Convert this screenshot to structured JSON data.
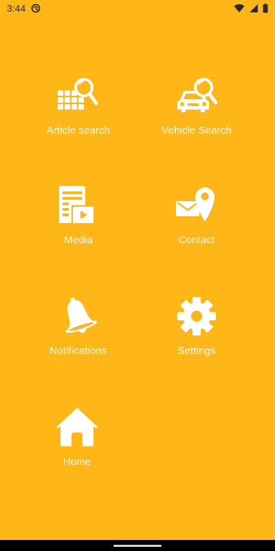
{
  "status_bar": {
    "time": "3:44"
  },
  "menu": {
    "article_search": "Article search",
    "vehicle_search": "Vehicle Search",
    "media": "Media",
    "contact": "Contact",
    "notifications": "Notifications",
    "settings": "Settings",
    "home": "Home"
  },
  "colors": {
    "background": "#FFB617",
    "icon": "#FFFFFF",
    "status_text": "#2B2B2B",
    "nav_bar": "#000000"
  },
  "icons": {
    "article_search": "grid-search-icon",
    "vehicle_search": "car-search-icon",
    "media": "document-video-icon",
    "contact": "envelope-location-icon",
    "notifications": "bell-icon",
    "settings": "gear-icon",
    "home": "house-icon"
  }
}
